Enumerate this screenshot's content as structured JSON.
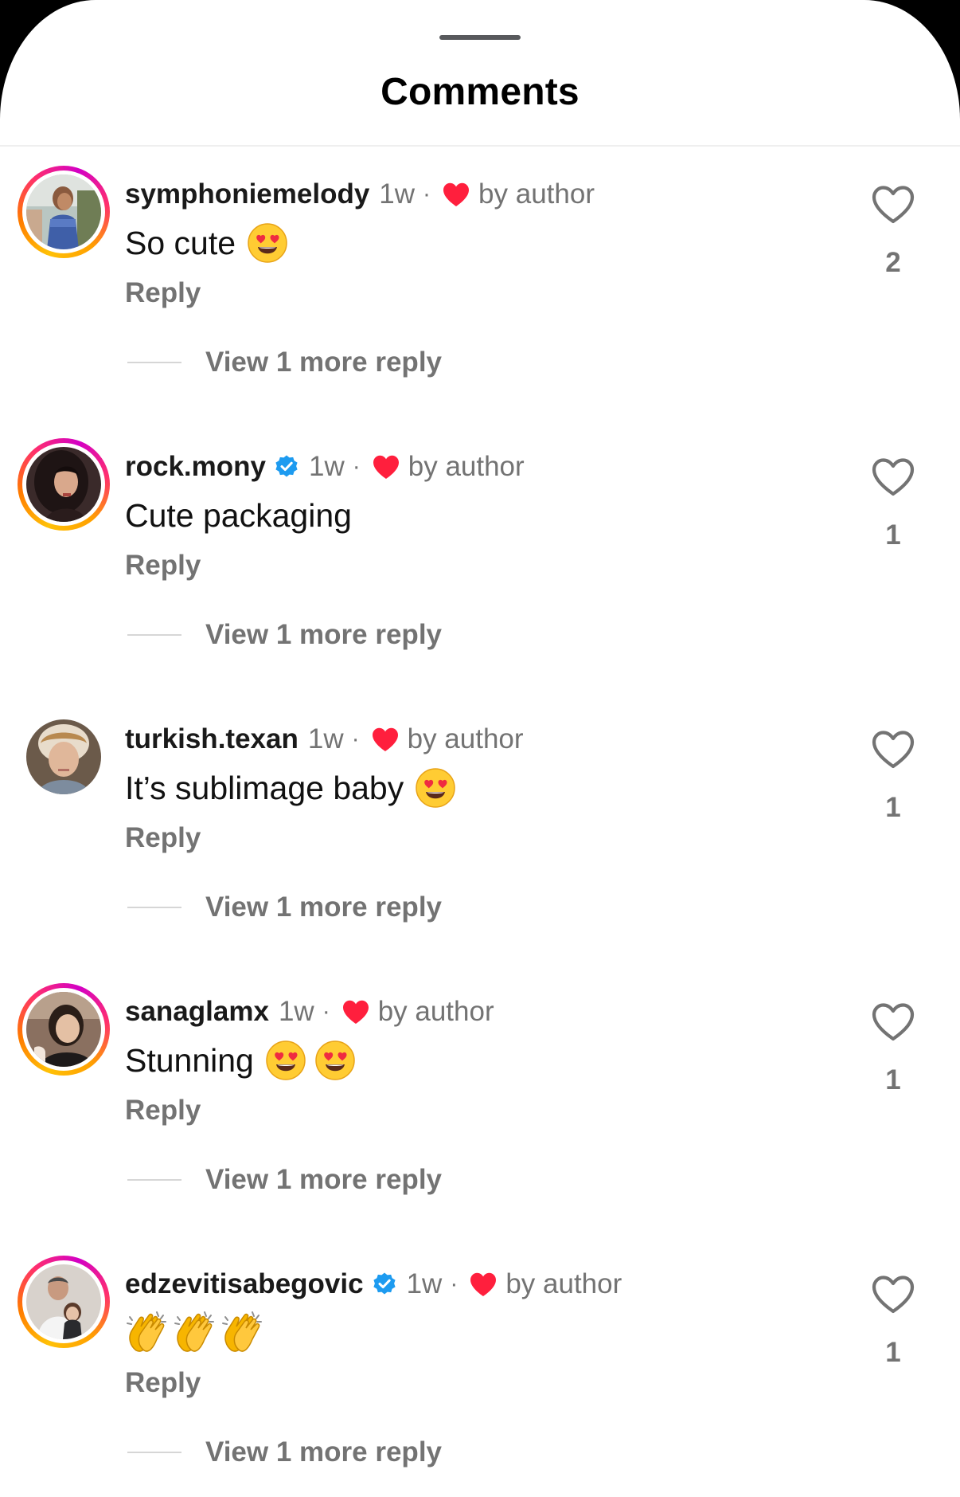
{
  "header": {
    "title": "Comments"
  },
  "colors": {
    "background": "#ffffff",
    "primary_text": "#000000",
    "secondary_text": "#737373",
    "heart_red": "#ff1f3d",
    "verified_blue": "#1d9bf0"
  },
  "comments": [
    {
      "username": "symphoniemelody",
      "verified": false,
      "age": "1w",
      "separator": "·",
      "author_label": "by author",
      "text": "So cute",
      "emojis": [
        "smiling-face-with-heart-eyes"
      ],
      "reply_label": "Reply",
      "view_more_label": "View 1 more reply",
      "likes": "2",
      "story_ring": true
    },
    {
      "username": "rock.mony",
      "verified": true,
      "age": "1w",
      "separator": "·",
      "author_label": "by author",
      "text": "Cute packaging",
      "emojis": [],
      "reply_label": "Reply",
      "view_more_label": "View 1 more reply",
      "likes": "1",
      "story_ring": true
    },
    {
      "username": "turkish.texan",
      "verified": false,
      "age": "1w",
      "separator": "·",
      "author_label": "by author",
      "text": "It’s sublimage baby",
      "emojis": [
        "smiling-face-with-heart-eyes"
      ],
      "reply_label": "Reply",
      "view_more_label": "View 1 more reply",
      "likes": "1",
      "story_ring": false
    },
    {
      "username": "sanaglamx",
      "verified": false,
      "age": "1w",
      "separator": "·",
      "author_label": "by author",
      "text": "Stunning",
      "emojis": [
        "smiling-face-with-heart-eyes",
        "smiling-face-with-heart-eyes"
      ],
      "reply_label": "Reply",
      "view_more_label": "View 1 more reply",
      "likes": "1",
      "story_ring": true
    },
    {
      "username": "edzevitisabegovic",
      "verified": true,
      "age": "1w",
      "separator": "·",
      "author_label": "by author",
      "text": "",
      "emojis": [
        "clapping-hands",
        "clapping-hands",
        "clapping-hands"
      ],
      "reply_label": "Reply",
      "view_more_label": "View 1 more reply",
      "likes": "1",
      "story_ring": true
    }
  ]
}
